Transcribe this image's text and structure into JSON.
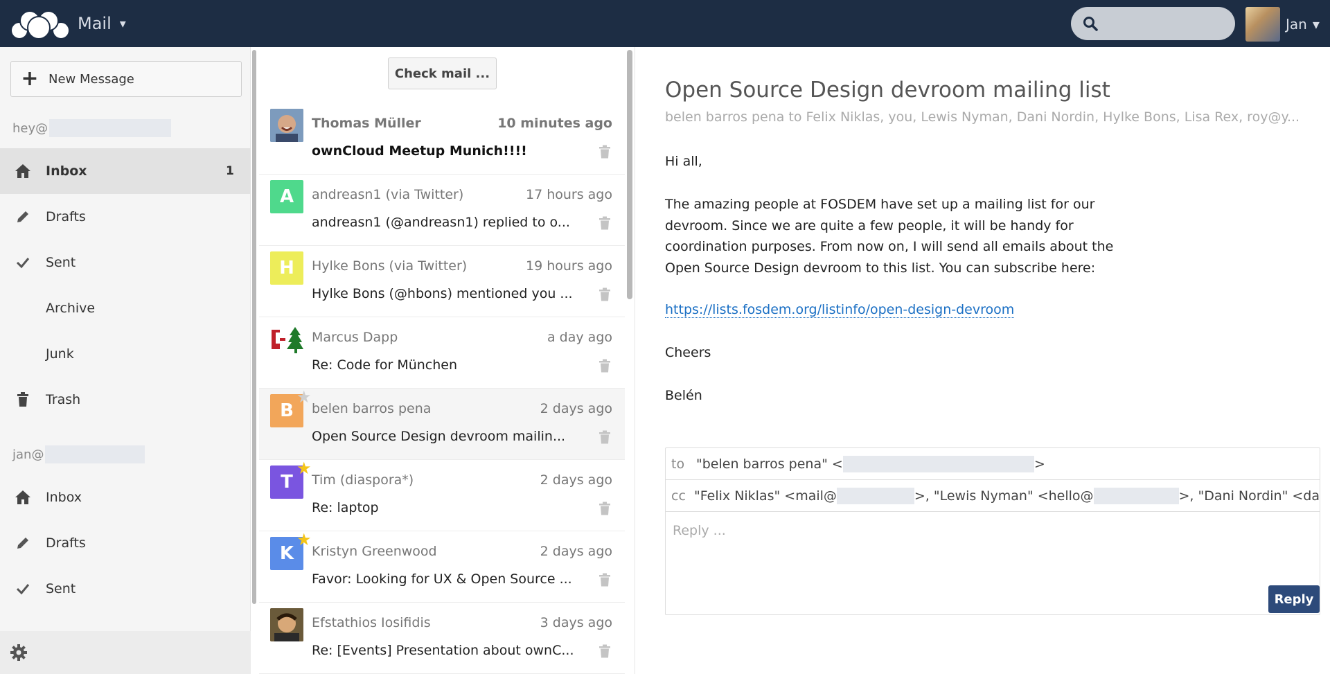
{
  "header": {
    "app_name": "Mail",
    "app_caret": "▾",
    "user_name": "Jan",
    "user_caret": "▾"
  },
  "nav": {
    "new_message_label": "New Message",
    "account1": "hey@",
    "account1_items": [
      {
        "label": "Inbox",
        "icon": "home-icon",
        "count": "1"
      },
      {
        "label": "Drafts",
        "icon": "pencil-icon",
        "count": ""
      },
      {
        "label": "Sent",
        "icon": "checkmark-icon",
        "count": ""
      },
      {
        "label": "Archive",
        "icon": "",
        "count": ""
      },
      {
        "label": "Junk",
        "icon": "",
        "count": ""
      },
      {
        "label": "Trash",
        "icon": "trash-icon",
        "count": ""
      }
    ],
    "account2": "jan@",
    "account2_items": [
      {
        "label": "Inbox",
        "icon": "home-icon"
      },
      {
        "label": "Drafts",
        "icon": "pencil-icon"
      },
      {
        "label": "Sent",
        "icon": "checkmark-icon"
      }
    ]
  },
  "list": {
    "check_mail_label": "Check mail ...",
    "messages": [
      {
        "from": "Thomas Müller",
        "time": "10 minutes ago",
        "subject": "ownCloud Meetup Munich!!!!",
        "avatar": "",
        "avatar_color": "#6a8caf",
        "starred": false,
        "unread": true
      },
      {
        "from": "andreasn1 (via Twitter)",
        "time": "17 hours ago",
        "subject": "andreasn1 (@andreasn1) replied to o...",
        "avatar": "A",
        "avatar_color": "#4fd98c",
        "starred": false,
        "unread": false
      },
      {
        "from": "Hylke Bons (via Twitter)",
        "time": "19 hours ago",
        "subject": "Hylke Bons (@hbons) mentioned you ...",
        "avatar": "H",
        "avatar_color": "#eded5a",
        "starred": false,
        "unread": false
      },
      {
        "from": "Marcus Dapp",
        "time": "a day ago",
        "subject": "Re: Code for München",
        "avatar": "",
        "avatar_color": "#ffffff",
        "starred": false,
        "unread": false
      },
      {
        "from": "belen barros pena",
        "time": "2 days ago",
        "subject": "Open Source Design devroom mailin...",
        "avatar": "B",
        "avatar_color": "#f2a65a",
        "starred": false,
        "unread": false
      },
      {
        "from": "Tim (diaspora*)",
        "time": "2 days ago",
        "subject": "Re: laptop",
        "avatar": "T",
        "avatar_color": "#7a55e0",
        "starred": true,
        "unread": false
      },
      {
        "from": "Kristyn Greenwood",
        "time": "2 days ago",
        "subject": "Favor: Looking for UX & Open Source ...",
        "avatar": "K",
        "avatar_color": "#5a8ce8",
        "starred": true,
        "unread": false
      },
      {
        "from": "Efstathios Iosifidis",
        "time": "3 days ago",
        "subject": "Re: [Events] Presentation about ownC...",
        "avatar": "",
        "avatar_color": "#8a6a4a",
        "starred": false,
        "unread": false
      }
    ]
  },
  "reader": {
    "subject": "Open Source Design devroom mailing list",
    "recipients": "belen barros pena to Felix Niklas, you, Lewis Nyman, Dani Nordin, Hylke Bons, Lisa Rex, roy@y...",
    "greeting": "Hi all,",
    "para_lines": [
      "The amazing people at FOSDEM have set up a mailing list for our",
      "devroom. Since we are quite a few people, it will be handy for",
      "coordination purposes. From now on, I will send all emails about the",
      "Open Source Design devroom to this list. You can subscribe here:"
    ],
    "link": "https://lists.fosdem.org/listinfo/open-design-devroom",
    "closing": "Cheers",
    "signature": "Belén",
    "reply": {
      "to_key": "to",
      "to_value_start": "\"belen barros pena\" <",
      "to_value_end": ">",
      "cc_key": "cc",
      "cc_part1": "\"Felix Niklas\" <mail@",
      "cc_part2": ">, \"Lewis Nyman\" <hello@",
      "cc_part3": ">, \"Dani Nordin\" <da",
      "placeholder": "Reply ...",
      "button_label": "Reply"
    }
  }
}
